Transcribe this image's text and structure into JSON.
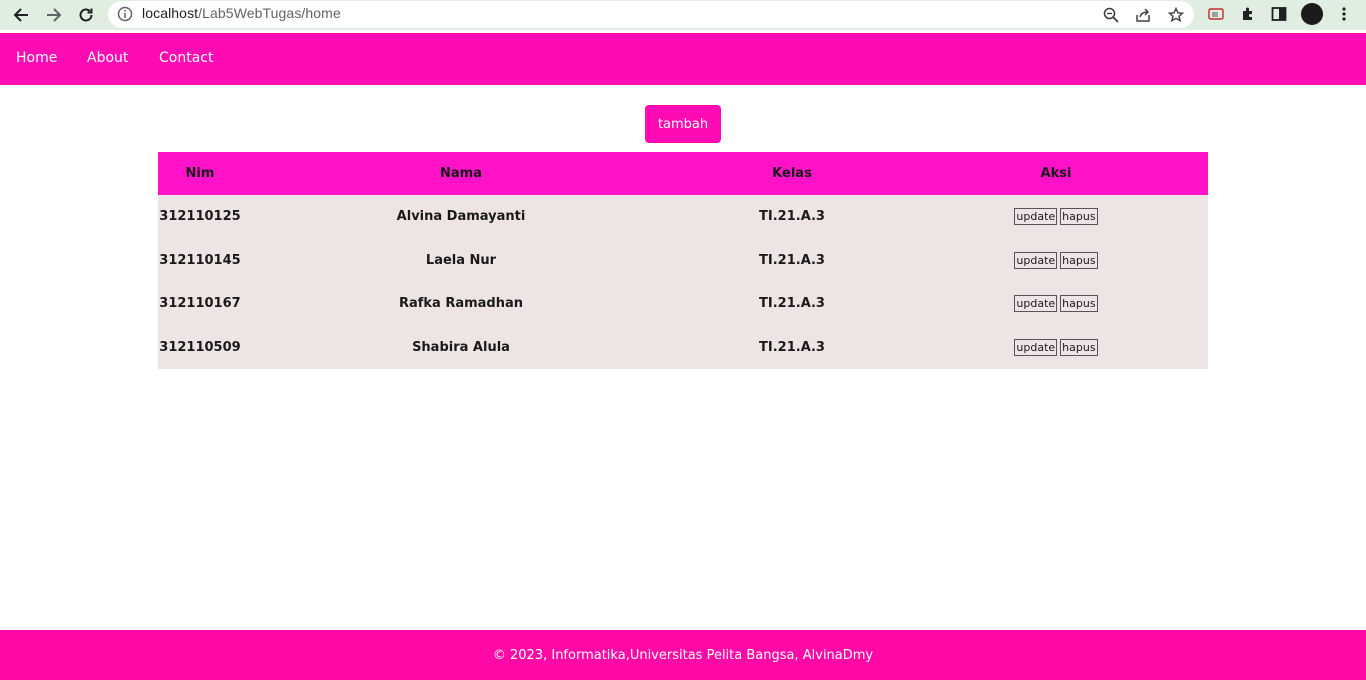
{
  "browser": {
    "url_host": "localhost",
    "url_path": "/Lab5WebTugas/home",
    "icons": [
      "back-arrow-icon",
      "forward-arrow-icon",
      "reload-icon",
      "info-icon",
      "zoom-icon",
      "share-icon",
      "bookmark-star-icon",
      "cast-icon",
      "extensions-puzzle-icon",
      "side-panel-icon",
      "profile-avatar",
      "menu-kebab-icon"
    ]
  },
  "nav": {
    "home": "Home",
    "about": "About",
    "contact": "Contact"
  },
  "add_button": "tambah",
  "table": {
    "headers": {
      "nim": "Nim",
      "nama": "Nama",
      "kelas": "Kelas",
      "aksi": "Aksi"
    },
    "update_label": "update",
    "delete_label": "hapus",
    "rows": [
      {
        "nim": "312110125",
        "nama": "Alvina Damayanti",
        "kelas": "TI.21.A.3"
      },
      {
        "nim": "312110145",
        "nama": "Laela Nur",
        "kelas": "TI.21.A.3"
      },
      {
        "nim": "312110167",
        "nama": "Rafka Ramadhan",
        "kelas": "TI.21.A.3"
      },
      {
        "nim": "312110509",
        "nama": "Shabira Alula",
        "kelas": "TI.21.A.3"
      }
    ]
  },
  "footer": "© 2023, Informatika,Universitas Pelita Bangsa, AlvinaDmy",
  "colors": {
    "nav_bg": "#ff0bb4",
    "header_bg": "#ff12c8",
    "row_bg": "#efe4e4",
    "footer_bg": "#ff0aa6",
    "chrome_bg": "#dfeee0"
  }
}
